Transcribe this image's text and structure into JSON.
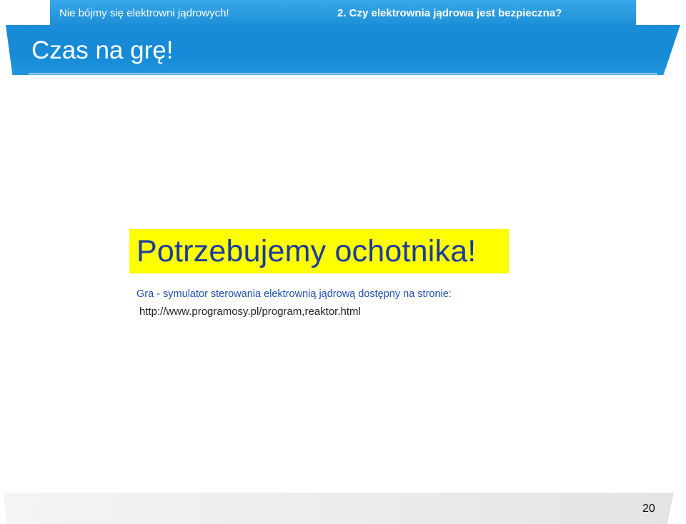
{
  "header": {
    "left_text": "Nie bójmy się elektrowni jądrowych!",
    "right_text": "2. Czy elektrownia jądrowa jest bezpieczna?"
  },
  "slide": {
    "title": "Czas na grę!",
    "highlight": "Potrzebujemy ochotnika!",
    "description": "Gra - symulator sterowania elektrownią jądrową dostępny na stronie:",
    "url": "http://www.programosy.pl/program,reaktor.html"
  },
  "footer": {
    "page_number": "20"
  },
  "colors": {
    "header_blue": "#1a8cd8",
    "highlight_yellow": "#ffff00",
    "highlight_text": "#1b3ba0",
    "description_text": "#1f4fb0"
  }
}
